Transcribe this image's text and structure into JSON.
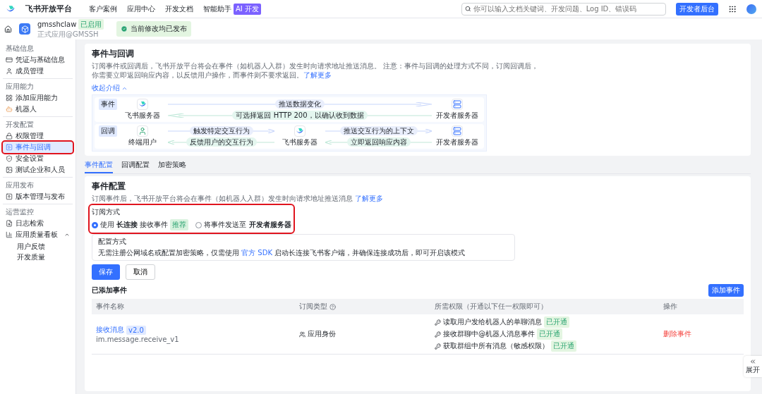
{
  "top_nav": {
    "logo": "飞书开放平台",
    "links": [
      {
        "label": "客户案例"
      },
      {
        "label": "应用中心"
      },
      {
        "label": "开发文档"
      },
      {
        "label": "智能助手",
        "badge": "AI 开发"
      }
    ],
    "search": {
      "placeholder": "你可以输入文档关键词、开发问题、Log ID、错误码"
    },
    "console_button": "开发者后台"
  },
  "app_header": {
    "name": "gmsshclaw",
    "status": "已启用",
    "subtitle": "正式应用@GMSSH",
    "publish_status": "当前修改均已发布"
  },
  "sidebar": {
    "sections": [
      {
        "title": "基础信息",
        "items": [
          {
            "label": "凭证与基础信息",
            "selected": false,
            "highlighted": false
          },
          {
            "label": "成员管理",
            "selected": false,
            "highlighted": false
          }
        ]
      },
      {
        "title": "应用能力",
        "items": [
          {
            "label": "添加应用能力",
            "selected": false,
            "highlighted": false
          },
          {
            "label": "机器人",
            "selected": false,
            "highlighted": false
          }
        ]
      },
      {
        "title": "开发配置",
        "items": [
          {
            "label": "权限管理",
            "selected": false,
            "highlighted": false
          },
          {
            "label": "事件与回调",
            "selected": true,
            "highlighted": true
          },
          {
            "label": "安全设置",
            "selected": false,
            "highlighted": false
          },
          {
            "label": "测试企业和人员",
            "selected": false,
            "highlighted": false
          }
        ]
      },
      {
        "title": "应用发布",
        "items": [
          {
            "label": "版本管理与发布",
            "selected": false,
            "highlighted": false
          }
        ]
      },
      {
        "title": "运营监控",
        "items": [
          {
            "label": "日志检索",
            "selected": false,
            "highlighted": false
          },
          {
            "label": "应用质量看板",
            "selected": false,
            "highlighted": false,
            "expanded": true,
            "children": [
              {
                "label": "用户反馈",
                "selected": false
              },
              {
                "label": "开发质量",
                "selected": false
              }
            ]
          }
        ]
      }
    ]
  },
  "intro": {
    "title": "事件与回调",
    "description": "订阅事件或回调后，飞书开放平台将会在事件（如机器人入群）发生时向请求地址推送消息。 注意：事件与回调的处理方式不同，订阅回调后，你需要立即返回响应内容，以反馈用户操作，而事件则不要求返回。",
    "link": "了解更多",
    "collapse": "收起介绍",
    "diagram": [
      {
        "tag": "事件",
        "items": [
          {
            "kind": "platform",
            "label": "飞书服务器"
          },
          {
            "kind": "arrows",
            "forward": "推送数据变化",
            "back": "可选择返回 HTTP 200，以确认收到数据"
          },
          {
            "kind": "server",
            "label": "开发者服务器"
          }
        ]
      },
      {
        "tag": "回调",
        "items": [
          {
            "kind": "person",
            "label": "终端用户"
          },
          {
            "kind": "arrows",
            "forward": "触发特定交互行为",
            "back": "反馈用户的交互行为"
          },
          {
            "kind": "platform",
            "label": "飞书服务器"
          },
          {
            "kind": "arrows",
            "forward": "推送交互行为的上下文",
            "back": "立即返回响应内容"
          },
          {
            "kind": "server",
            "label": "开发者服务器"
          }
        ]
      }
    ]
  },
  "tabs": [
    {
      "label": "事件配置",
      "selected": true
    },
    {
      "label": "回调配置",
      "selected": false
    },
    {
      "label": "加密策略",
      "selected": false
    }
  ],
  "event_config": {
    "title": "事件配置",
    "description": "订阅事件后，飞书开放平台将会在事件（如机器人入群）发生时向请求地址推送消息",
    "link": "了解更多",
    "subscription": {
      "label": "订阅方式",
      "highlighted": true,
      "options": [
        {
          "label": "使用 **长连接** 接收事件",
          "badge": "推荐",
          "selected": true
        },
        {
          "label": "将事件发送至 **开发者服务器**",
          "selected": false
        }
      ]
    },
    "config_box": {
      "title": "配置方式",
      "text_before": "无需注册公网域名或配置加密策略，仅需使用",
      "link": "官方 SDK",
      "text_after": "启动长连接飞书客户端，并确保连接成功后，即可开启该模式"
    },
    "save_button": "保存",
    "cancel_button": "取消"
  },
  "added_events": {
    "title": "已添加事件",
    "add_button": "添加事件",
    "columns": [
      {
        "label": "事件名称",
        "help": false
      },
      {
        "label": "订阅类型",
        "help": true
      },
      {
        "label": "所需权限（开通以下任一权限即可）",
        "help": false
      },
      {
        "label": "操作",
        "help": false
      }
    ],
    "rows": [
      {
        "name": "接收消息",
        "version": "v2.0",
        "code": "im.message.receive_v1",
        "type": "应用身份",
        "permissions": [
          {
            "label": "读取用户发给机器人的单聊消息",
            "status": "已开通"
          },
          {
            "label": "接收群聊中@机器人消息事件",
            "status": "已开通"
          },
          {
            "label": "获取群组中所有消息（敏感权限）",
            "status": "已开通"
          }
        ],
        "action": "删除事件"
      }
    ]
  },
  "expand_tab": "展开"
}
